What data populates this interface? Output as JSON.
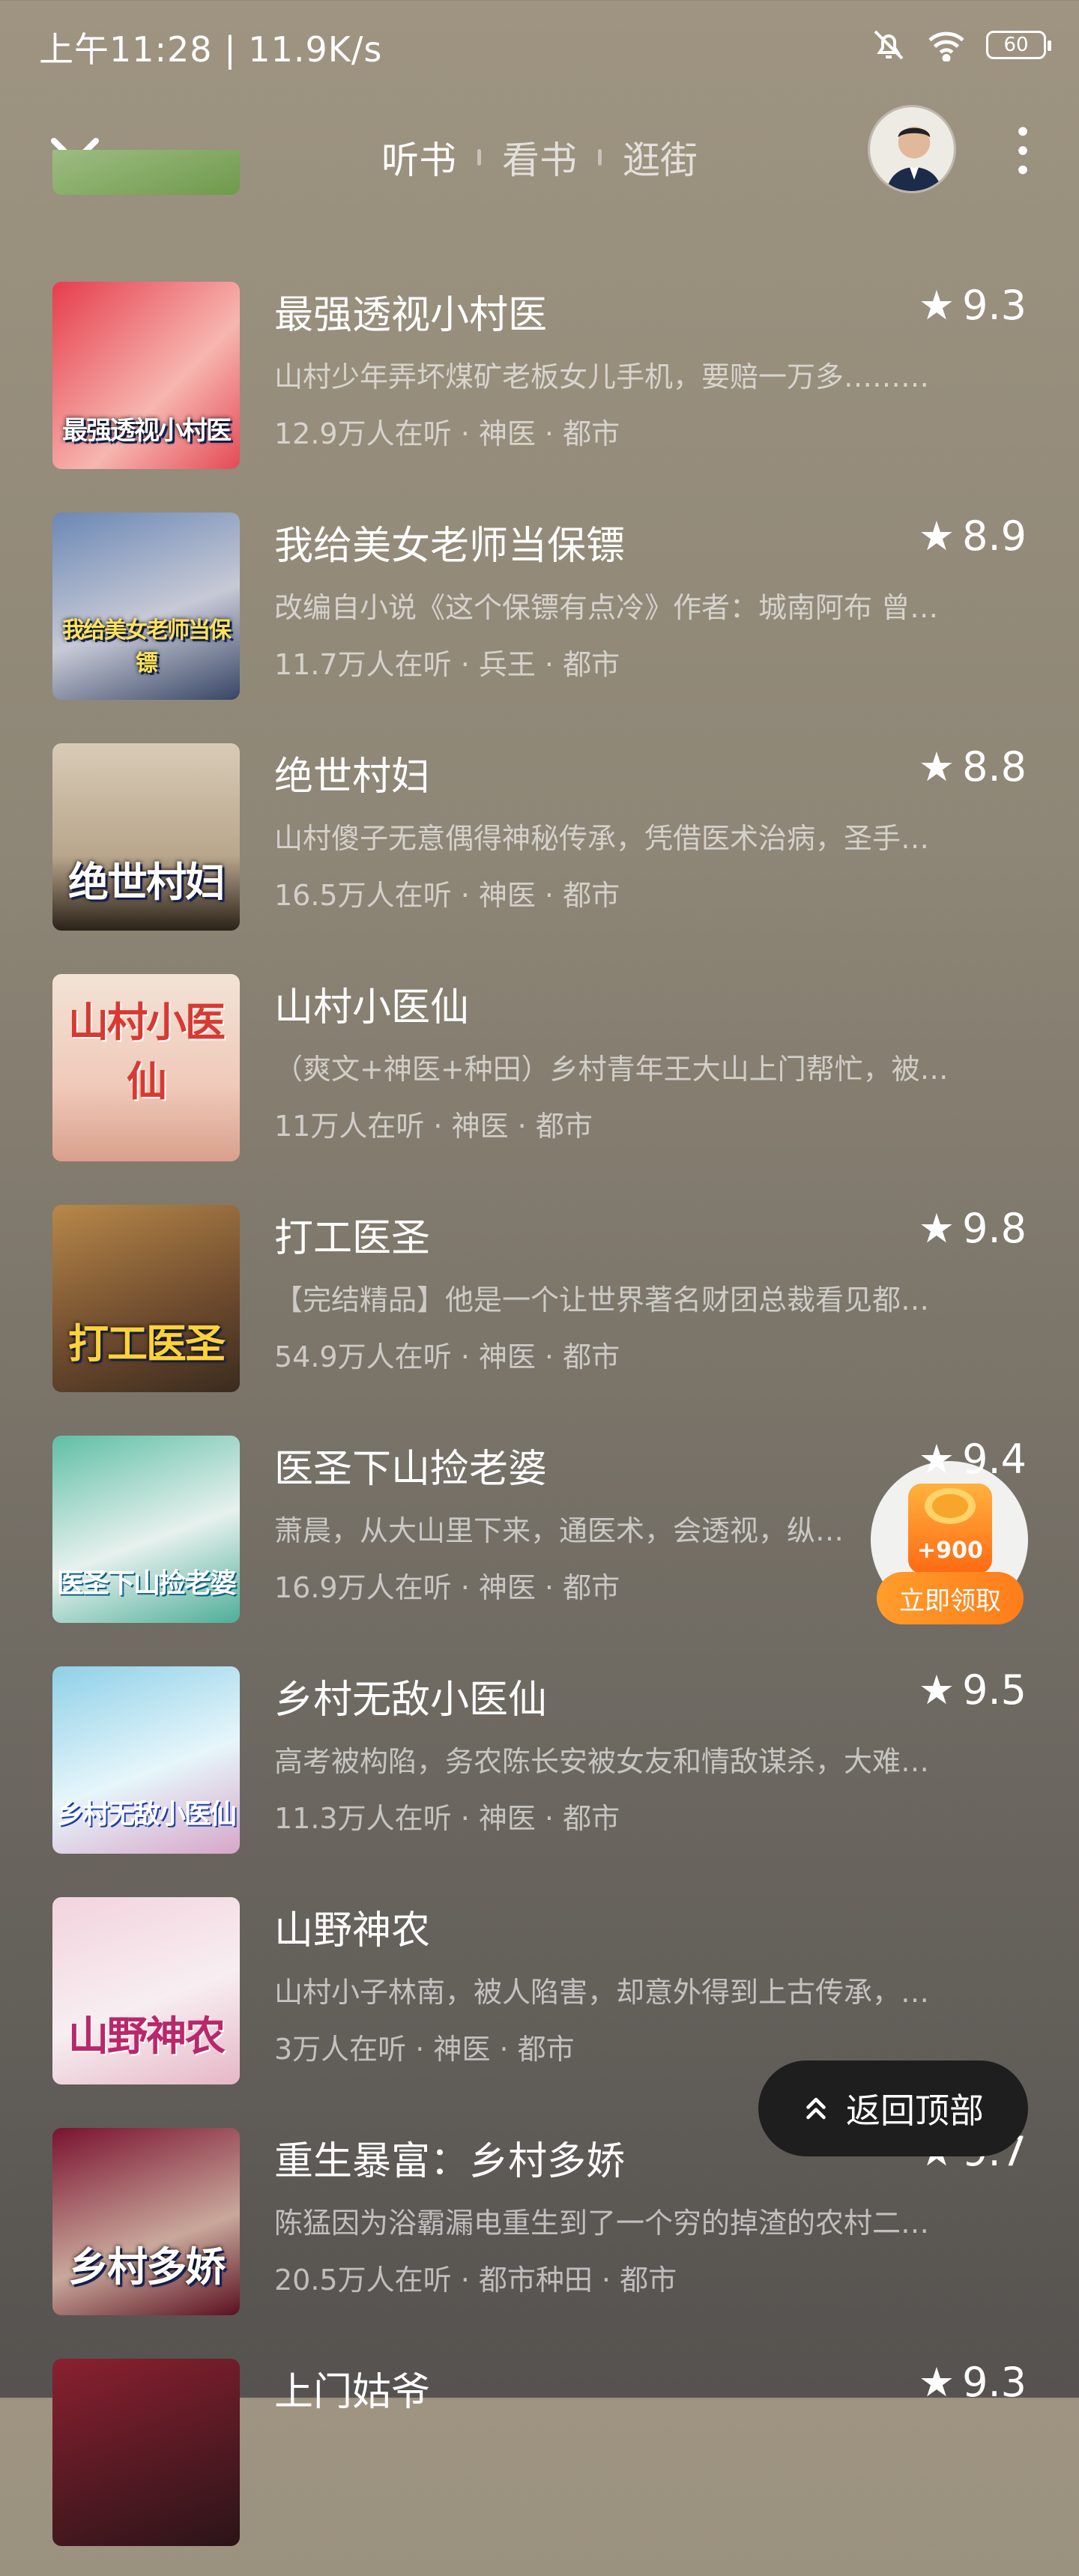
{
  "status_bar": {
    "time": "上午11:28 | 11.9K/s",
    "battery": "60",
    "icons": [
      "bell-off-icon",
      "wifi-icon",
      "battery-icon"
    ]
  },
  "nav": {
    "tabs": [
      "听书",
      "看书",
      "逛街"
    ],
    "active_tab": "听书",
    "back_icon": "chevron-down-icon",
    "more_icon": "more-vertical-icon"
  },
  "books": [
    {
      "title": "最强透视小村医",
      "rating": "9.3",
      "desc": "山村少年弄坏煤矿老板女儿手机，要赔一万多………",
      "meta": "12.9万人在听 · 神医 · 都市",
      "cover_text": "最强透视小村医",
      "cover_colors": [
        "#e63d4c",
        "#f7b6b0"
      ]
    },
    {
      "title": "我给美女老师当保镖",
      "rating": "8.9",
      "desc": "改编自小说《这个保镖有点冷》作者：城南阿布 曾…",
      "meta": "11.7万人在听 · 兵王 · 都市",
      "cover_text": "我给美女老师当保镖",
      "cover_colors": [
        "#6b88b5",
        "#c7c9d6"
      ]
    },
    {
      "title": "绝世村妇",
      "rating": "8.8",
      "desc": "山村傻子无意偶得神秘传承，凭借医术治病，圣手…",
      "meta": "16.5万人在听 · 神医 · 都市",
      "cover_text": "绝世村妇",
      "cover_colors": [
        "#d8cbb6",
        "#2a2118"
      ]
    },
    {
      "title": "山村小医仙",
      "rating": "",
      "desc": "（爽文+神医+种田）乡村青年王大山上门帮忙，被…",
      "meta": "11万人在听 · 神医 · 都市",
      "cover_text": "山村小医仙",
      "cover_colors": [
        "#f2e3d6",
        "#d63a32"
      ]
    },
    {
      "title": "打工医圣",
      "rating": "9.8",
      "desc": "【完结精品】他是一个让世界著名财团总裁看见都…",
      "meta": "54.9万人在听 · 神医 · 都市",
      "cover_text": "打工医圣",
      "cover_colors": [
        "#b8884a",
        "#3a2b1e"
      ]
    },
    {
      "title": "医圣下山捡老婆",
      "rating": "9.4",
      "desc": "萧晨，从大山里下来，通医术，会透视，纵…",
      "meta": "16.9万人在听 · 神医 · 都市",
      "cover_text": "医圣下山捡老婆",
      "cover_colors": [
        "#5fbfa6",
        "#e7f1ee"
      ]
    },
    {
      "title": "乡村无敌小医仙",
      "rating": "9.5",
      "desc": "高考被构陷，务农陈长安被女友和情敌谋杀，大难…",
      "meta": "11.3万人在听 · 神医 · 都市",
      "cover_text": "乡村无敌小医仙",
      "cover_colors": [
        "#8fd0e8",
        "#e6f6fb"
      ]
    },
    {
      "title": "山野神农",
      "rating": "",
      "desc": "山村小子林南，被人陷害，却意外得到上古传承，…",
      "meta": "3万人在听 · 神医 · 都市",
      "cover_text": "山野神农",
      "cover_colors": [
        "#f3d3dd",
        "#b8286a"
      ]
    },
    {
      "title": "重生暴富：乡村多娇",
      "rating": "9.7",
      "desc": "陈猛因为浴霸漏电重生到了一个穷的掉渣的农村二…",
      "meta": "20.5万人在听 · 都市种田 · 都市",
      "cover_text": "乡村多娇",
      "cover_colors": [
        "#7a1230",
        "#c9a89b"
      ]
    },
    {
      "title": "上门姑爷",
      "rating": "9.3",
      "desc": "",
      "meta": "",
      "cover_text": "",
      "cover_colors": [
        "#8a2030",
        "#2a1418"
      ]
    }
  ],
  "reward": {
    "amount": "+900",
    "button": "立即领取"
  },
  "back_to_top": {
    "label": "返回顶部"
  }
}
